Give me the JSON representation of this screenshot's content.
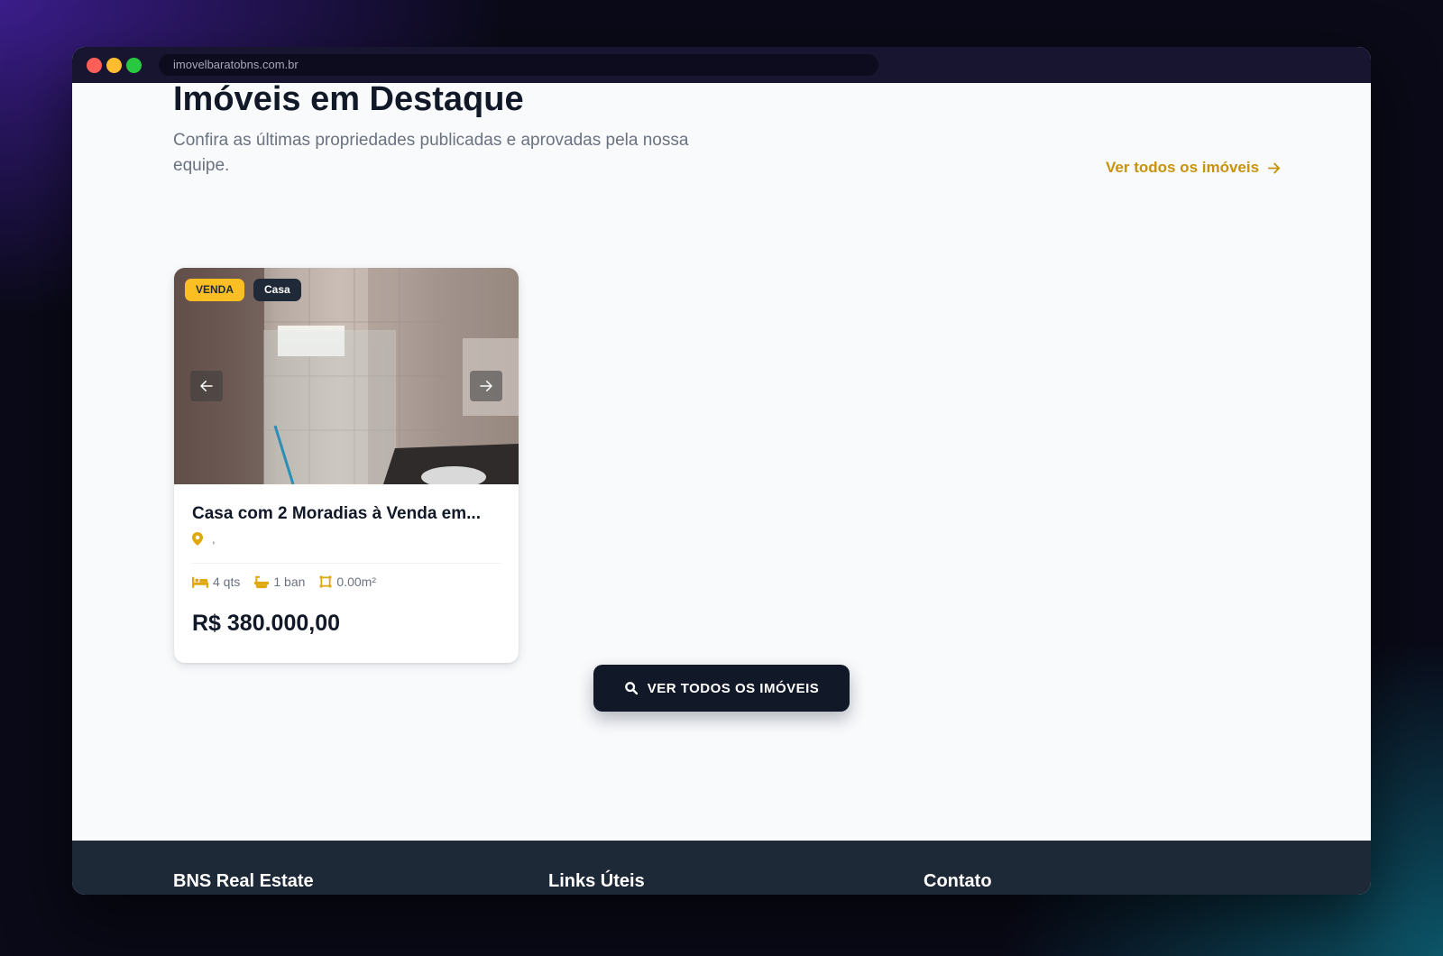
{
  "browser": {
    "url": "imovelbaratobns.com.br"
  },
  "section": {
    "title": "Imóveis em Destaque",
    "subtitle": "Confira as últimas propriedades publicadas e aprovadas pela nossa equipe.",
    "see_all_link": "Ver todos os imóveis"
  },
  "listing": {
    "badge_status": "VENDA",
    "badge_type": "Casa",
    "title": "Casa com 2 Moradias à Venda em...",
    "location": ",",
    "features": {
      "bedrooms": "4 qts",
      "bathrooms": "1 ban",
      "area": "0.00m²"
    },
    "price": "R$ 380.000,00"
  },
  "cta": {
    "label": "VER TODOS OS IMÓVEIS"
  },
  "footer": {
    "brand": "BNS Real Estate",
    "links_heading": "Links Úteis",
    "contact_heading": "Contato"
  },
  "colors": {
    "accent": "#c8930c",
    "badge_yellow": "#fbbf24",
    "dark": "#111827",
    "footer_bg": "#1e2937"
  }
}
